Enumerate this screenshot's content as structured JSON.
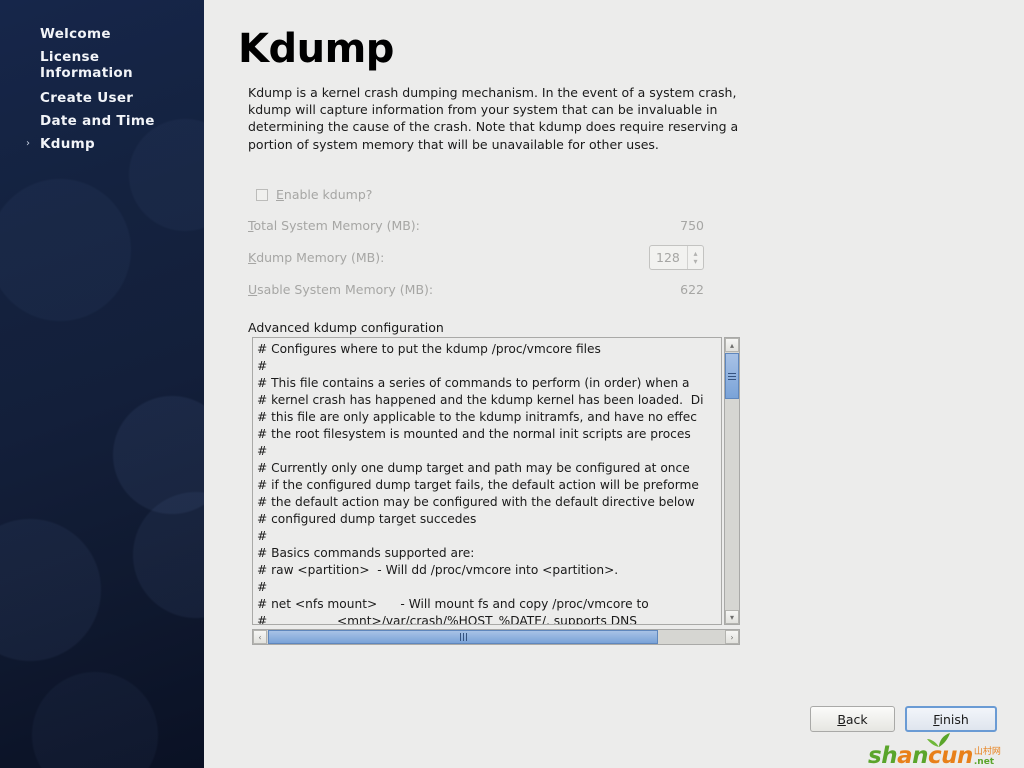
{
  "sidebar": {
    "items": [
      {
        "label": "Welcome",
        "active": false
      },
      {
        "label": "License\nInformation",
        "active": false
      },
      {
        "label": "Create User",
        "active": false
      },
      {
        "label": "Date and Time",
        "active": false
      },
      {
        "label": "Kdump",
        "active": true
      }
    ],
    "active_marker": "›"
  },
  "main": {
    "title": "Kdump",
    "description": "Kdump is a kernel crash dumping mechanism. In the event of a system crash, kdump will capture information from your system that can be invaluable in determining the cause of the crash. Note that kdump does require reserving a portion of system memory that will be unavailable for other uses.",
    "enable_checkbox": {
      "mnemonic": "E",
      "label_rest": "nable kdump?",
      "checked": false,
      "enabled": false
    },
    "fields": [
      {
        "mnemonic": "T",
        "label_rest": "otal System Memory (MB):",
        "value": "750",
        "type": "readonly"
      },
      {
        "mnemonic": "K",
        "label_rest": "dump Memory (MB):",
        "value": "128",
        "type": "spinner"
      },
      {
        "mnemonic": "U",
        "label_rest": "sable System Memory (MB):",
        "value": "622",
        "type": "readonly"
      }
    ],
    "advanced_label": "Advanced kdump configuration",
    "config_lines": [
      "# Configures where to put the kdump /proc/vmcore files",
      "#",
      "# This file contains a series of commands to perform (in order) when a",
      "# kernel crash has happened and the kdump kernel has been loaded.  Di",
      "# this file are only applicable to the kdump initramfs, and have no effec",
      "# the root filesystem is mounted and the normal init scripts are proces",
      "#",
      "# Currently only one dump target and path may be configured at once",
      "# if the configured dump target fails, the default action will be preforme",
      "# the default action may be configured with the default directive below",
      "# configured dump target succedes",
      "#",
      "# Basics commands supported are:",
      "# raw <partition>  - Will dd /proc/vmcore into <partition>.",
      "#",
      "# net <nfs mount>      - Will mount fs and copy /proc/vmcore to",
      "#                  <mnt>/var/crash/%HOST_%DATE/, supports DNS"
    ],
    "scroll_icons": {
      "up": "▴",
      "down": "▾",
      "left": "‹",
      "right": "›"
    }
  },
  "footer": {
    "back": {
      "mnemonic": "B",
      "label_rest": "ack"
    },
    "finish": {
      "mnemonic": "F",
      "label_rest": "inish"
    }
  },
  "watermark": {
    "part_green_1": "sh",
    "part_orange": "a",
    "part_green_2": "n",
    "part_orange_2": "cun",
    "cn": "山村网",
    "net": ".net"
  },
  "colors": {
    "sidebar_top": "#16264a",
    "sidebar_bottom": "#0a1124",
    "content_bg": "#ececeb",
    "accent_blue": "#7aa3d8",
    "focus_blue": "#6a9bd4",
    "disabled_text": "#a6a6a4",
    "watermark_green": "#5aa52b",
    "watermark_orange": "#e8801a"
  }
}
